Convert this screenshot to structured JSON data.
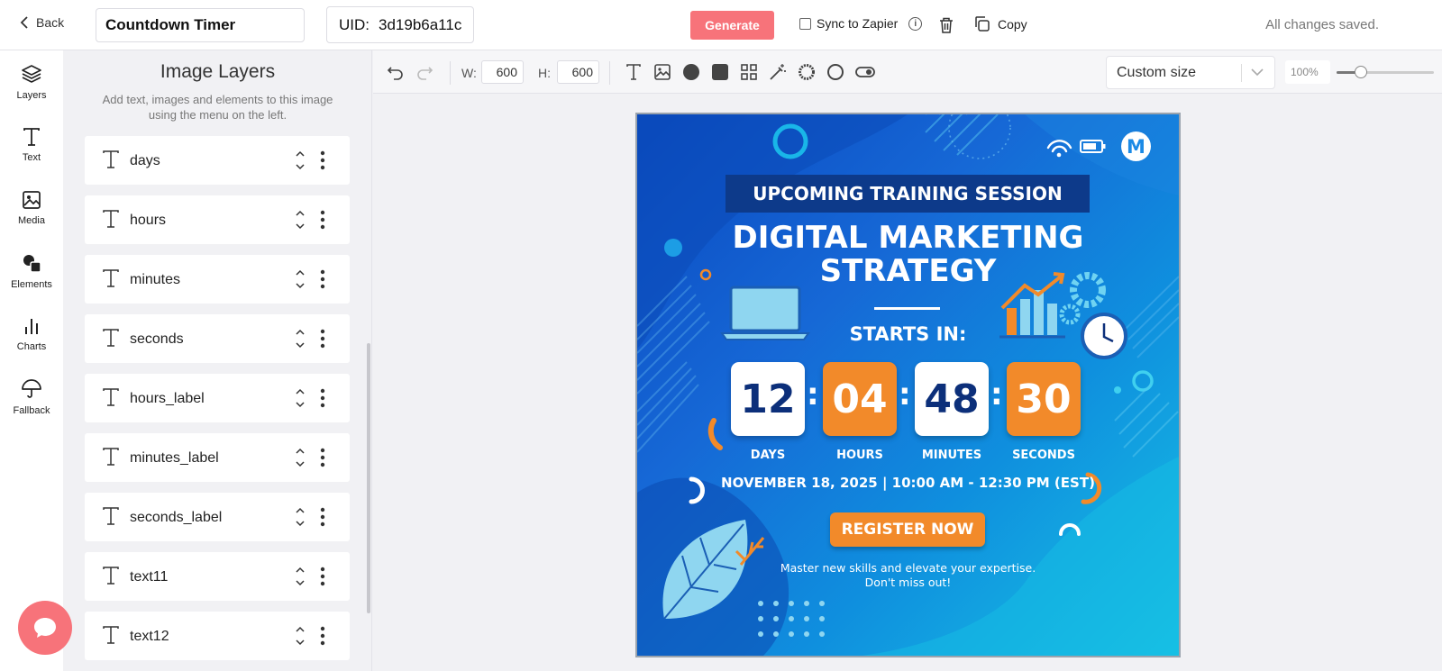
{
  "header": {
    "back_label": "Back",
    "template_name": "Countdown Timer",
    "uid_label": "UID:",
    "uid_value": "3d19b6a11c",
    "generate_label": "Generate",
    "sync_label": "Sync to Zapier",
    "copy_label": "Copy",
    "status_text": "All changes saved."
  },
  "rail": {
    "items": [
      {
        "label": "Layers",
        "icon": "layers-icon"
      },
      {
        "label": "Text",
        "icon": "text-icon"
      },
      {
        "label": "Media",
        "icon": "image-icon"
      },
      {
        "label": "Elements",
        "icon": "shapes-icon"
      },
      {
        "label": "Charts",
        "icon": "bar-chart-icon"
      },
      {
        "label": "Fallback",
        "icon": "umbrella-icon"
      }
    ]
  },
  "panel": {
    "title": "Image Layers",
    "subtitle": "Add text, images and elements to this image using the menu on the left.",
    "layers": [
      {
        "name": "days"
      },
      {
        "name": "hours"
      },
      {
        "name": "minutes"
      },
      {
        "name": "seconds"
      },
      {
        "name": "hours_label"
      },
      {
        "name": "minutes_label"
      },
      {
        "name": "seconds_label"
      },
      {
        "name": "text11"
      },
      {
        "name": "text12"
      }
    ]
  },
  "toolbar": {
    "w_label": "W:",
    "w_value": "600",
    "h_label": "H:",
    "h_value": "600",
    "size_option": "Custom size",
    "zoom_value": "100%",
    "zoom_fraction": 0.25
  },
  "poster": {
    "badge": "UPCOMING TRAINING SESSION",
    "title_line1": "DIGITAL MARKETING",
    "title_line2": "STRATEGY",
    "starts_in": "STARTS IN:",
    "days": "12",
    "hours": "04",
    "minutes": "48",
    "seconds": "30",
    "days_label": "DAYS",
    "hours_label": "HOURS",
    "minutes_label": "MINUTES",
    "seconds_label": "SECONDS",
    "date_line": "NOVEMBER 18, 2025 | 10:00 AM - 12:30 PM (EST)",
    "register": "REGISTER NOW",
    "tagline1": "Master new skills and elevate your expertise.",
    "tagline2": "Don't miss out!",
    "logo_letter": "M"
  },
  "colors": {
    "accent": "#f7737a",
    "poster_orange": "#f28a2a",
    "poster_navy": "#0d3a8a"
  }
}
